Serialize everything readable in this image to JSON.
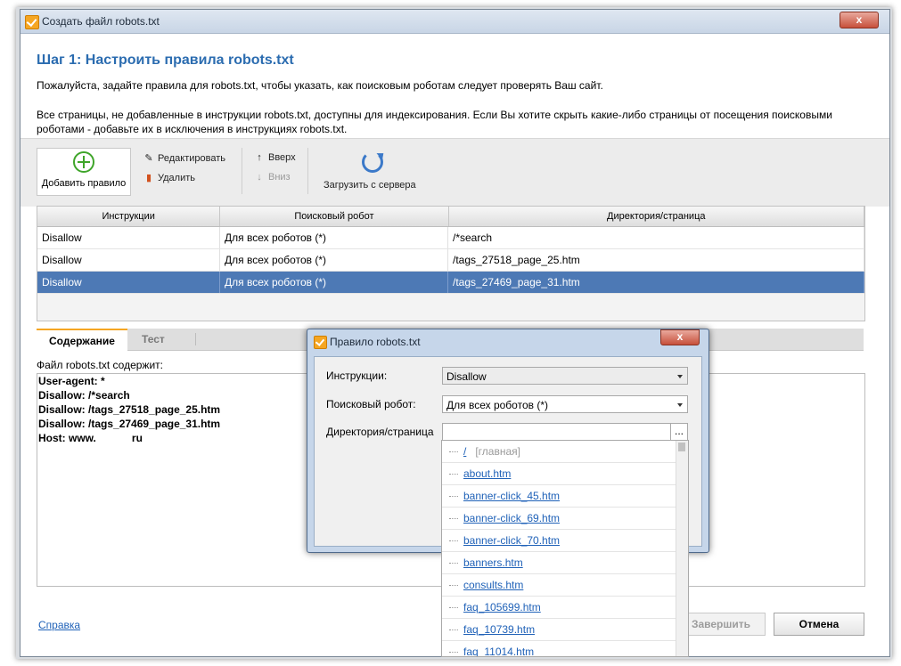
{
  "window": {
    "title": "Создать файл robots.txt",
    "close": "x"
  },
  "step": {
    "title": "Шаг 1: Настроить правила robots.txt",
    "description": "Пожалуйста, задайте правила для robots.txt, чтобы указать, как поисковым роботам следует проверять Ваш сайт.",
    "note": "Все страницы, не добавленные в инструкции robots.txt, доступны для индексирования. Если Вы хотите скрыть какие-либо страницы от посещения поисковыми роботами - добавьте их в исключения в инструкциях robots.txt."
  },
  "toolbar": {
    "add_rule": "Добавить правило",
    "edit": "Редактировать",
    "delete": "Удалить",
    "up": "Вверх",
    "down": "Вниз",
    "load_from_server": "Загрузить с сервера"
  },
  "grid": {
    "headers": [
      "Инструкции",
      "Поисковый робот",
      "Директория/страница"
    ],
    "rows": [
      [
        "Disallow",
        "Для всех роботов (*)",
        "/*search"
      ],
      [
        "Disallow",
        "Для всех роботов (*)",
        "/tags_27518_page_25.htm"
      ],
      [
        "Disallow",
        "Для всех роботов (*)",
        "/tags_27469_page_31.htm"
      ]
    ]
  },
  "tabs": {
    "content": "Содержание",
    "test": "Тест"
  },
  "content": {
    "label": "Файл robots.txt содержит:",
    "lines": [
      "User-agent: *",
      "Disallow: /*search",
      "Disallow: /tags_27518_page_25.htm",
      "Disallow: /tags_27469_page_31.htm",
      "Host: www.            ru"
    ]
  },
  "footer": {
    "help": "Справка",
    "finish": "Завершить",
    "cancel": "Отмена"
  },
  "dialog": {
    "title": "Правило robots.txt",
    "instruction_label": "Инструкции:",
    "instruction_value": "Disallow",
    "robot_label": "Поисковый робот:",
    "robot_value": "Для всех роботов (*)",
    "dir_label": "Директория/страница",
    "dir_value": "",
    "browse": "...",
    "list": [
      {
        "path": "/",
        "note": "[главная]"
      },
      {
        "path": "about.htm"
      },
      {
        "path": "banner-click_45.htm"
      },
      {
        "path": "banner-click_69.htm"
      },
      {
        "path": "banner-click_70.htm"
      },
      {
        "path": "banners.htm"
      },
      {
        "path": "consults.htm"
      },
      {
        "path": "faq_105699.htm"
      },
      {
        "path": "faq_10739.htm"
      },
      {
        "path": "faq_11014.htm"
      }
    ]
  },
  "colors": {
    "accent": "#2b6cb0",
    "selected_row": "#4d79b5",
    "add_icon": "#3fa52a"
  }
}
